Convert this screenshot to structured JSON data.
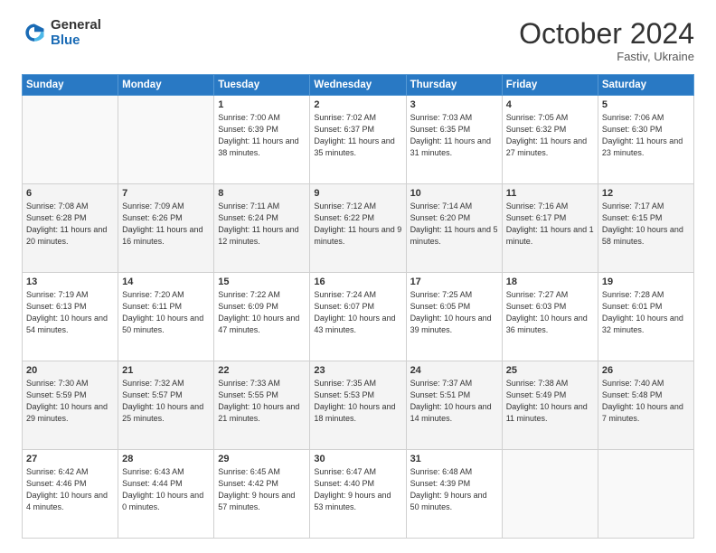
{
  "header": {
    "logo_general": "General",
    "logo_blue": "Blue",
    "title": "October 2024",
    "location": "Fastiv, Ukraine"
  },
  "days_of_week": [
    "Sunday",
    "Monday",
    "Tuesday",
    "Wednesday",
    "Thursday",
    "Friday",
    "Saturday"
  ],
  "weeks": [
    [
      {
        "day": "",
        "content": ""
      },
      {
        "day": "",
        "content": ""
      },
      {
        "day": "1",
        "content": "Sunrise: 7:00 AM\nSunset: 6:39 PM\nDaylight: 11 hours and 38 minutes."
      },
      {
        "day": "2",
        "content": "Sunrise: 7:02 AM\nSunset: 6:37 PM\nDaylight: 11 hours and 35 minutes."
      },
      {
        "day": "3",
        "content": "Sunrise: 7:03 AM\nSunset: 6:35 PM\nDaylight: 11 hours and 31 minutes."
      },
      {
        "day": "4",
        "content": "Sunrise: 7:05 AM\nSunset: 6:32 PM\nDaylight: 11 hours and 27 minutes."
      },
      {
        "day": "5",
        "content": "Sunrise: 7:06 AM\nSunset: 6:30 PM\nDaylight: 11 hours and 23 minutes."
      }
    ],
    [
      {
        "day": "6",
        "content": "Sunrise: 7:08 AM\nSunset: 6:28 PM\nDaylight: 11 hours and 20 minutes."
      },
      {
        "day": "7",
        "content": "Sunrise: 7:09 AM\nSunset: 6:26 PM\nDaylight: 11 hours and 16 minutes."
      },
      {
        "day": "8",
        "content": "Sunrise: 7:11 AM\nSunset: 6:24 PM\nDaylight: 11 hours and 12 minutes."
      },
      {
        "day": "9",
        "content": "Sunrise: 7:12 AM\nSunset: 6:22 PM\nDaylight: 11 hours and 9 minutes."
      },
      {
        "day": "10",
        "content": "Sunrise: 7:14 AM\nSunset: 6:20 PM\nDaylight: 11 hours and 5 minutes."
      },
      {
        "day": "11",
        "content": "Sunrise: 7:16 AM\nSunset: 6:17 PM\nDaylight: 11 hours and 1 minute."
      },
      {
        "day": "12",
        "content": "Sunrise: 7:17 AM\nSunset: 6:15 PM\nDaylight: 10 hours and 58 minutes."
      }
    ],
    [
      {
        "day": "13",
        "content": "Sunrise: 7:19 AM\nSunset: 6:13 PM\nDaylight: 10 hours and 54 minutes."
      },
      {
        "day": "14",
        "content": "Sunrise: 7:20 AM\nSunset: 6:11 PM\nDaylight: 10 hours and 50 minutes."
      },
      {
        "day": "15",
        "content": "Sunrise: 7:22 AM\nSunset: 6:09 PM\nDaylight: 10 hours and 47 minutes."
      },
      {
        "day": "16",
        "content": "Sunrise: 7:24 AM\nSunset: 6:07 PM\nDaylight: 10 hours and 43 minutes."
      },
      {
        "day": "17",
        "content": "Sunrise: 7:25 AM\nSunset: 6:05 PM\nDaylight: 10 hours and 39 minutes."
      },
      {
        "day": "18",
        "content": "Sunrise: 7:27 AM\nSunset: 6:03 PM\nDaylight: 10 hours and 36 minutes."
      },
      {
        "day": "19",
        "content": "Sunrise: 7:28 AM\nSunset: 6:01 PM\nDaylight: 10 hours and 32 minutes."
      }
    ],
    [
      {
        "day": "20",
        "content": "Sunrise: 7:30 AM\nSunset: 5:59 PM\nDaylight: 10 hours and 29 minutes."
      },
      {
        "day": "21",
        "content": "Sunrise: 7:32 AM\nSunset: 5:57 PM\nDaylight: 10 hours and 25 minutes."
      },
      {
        "day": "22",
        "content": "Sunrise: 7:33 AM\nSunset: 5:55 PM\nDaylight: 10 hours and 21 minutes."
      },
      {
        "day": "23",
        "content": "Sunrise: 7:35 AM\nSunset: 5:53 PM\nDaylight: 10 hours and 18 minutes."
      },
      {
        "day": "24",
        "content": "Sunrise: 7:37 AM\nSunset: 5:51 PM\nDaylight: 10 hours and 14 minutes."
      },
      {
        "day": "25",
        "content": "Sunrise: 7:38 AM\nSunset: 5:49 PM\nDaylight: 10 hours and 11 minutes."
      },
      {
        "day": "26",
        "content": "Sunrise: 7:40 AM\nSunset: 5:48 PM\nDaylight: 10 hours and 7 minutes."
      }
    ],
    [
      {
        "day": "27",
        "content": "Sunrise: 6:42 AM\nSunset: 4:46 PM\nDaylight: 10 hours and 4 minutes."
      },
      {
        "day": "28",
        "content": "Sunrise: 6:43 AM\nSunset: 4:44 PM\nDaylight: 10 hours and 0 minutes."
      },
      {
        "day": "29",
        "content": "Sunrise: 6:45 AM\nSunset: 4:42 PM\nDaylight: 9 hours and 57 minutes."
      },
      {
        "day": "30",
        "content": "Sunrise: 6:47 AM\nSunset: 4:40 PM\nDaylight: 9 hours and 53 minutes."
      },
      {
        "day": "31",
        "content": "Sunrise: 6:48 AM\nSunset: 4:39 PM\nDaylight: 9 hours and 50 minutes."
      },
      {
        "day": "",
        "content": ""
      },
      {
        "day": "",
        "content": ""
      }
    ]
  ]
}
